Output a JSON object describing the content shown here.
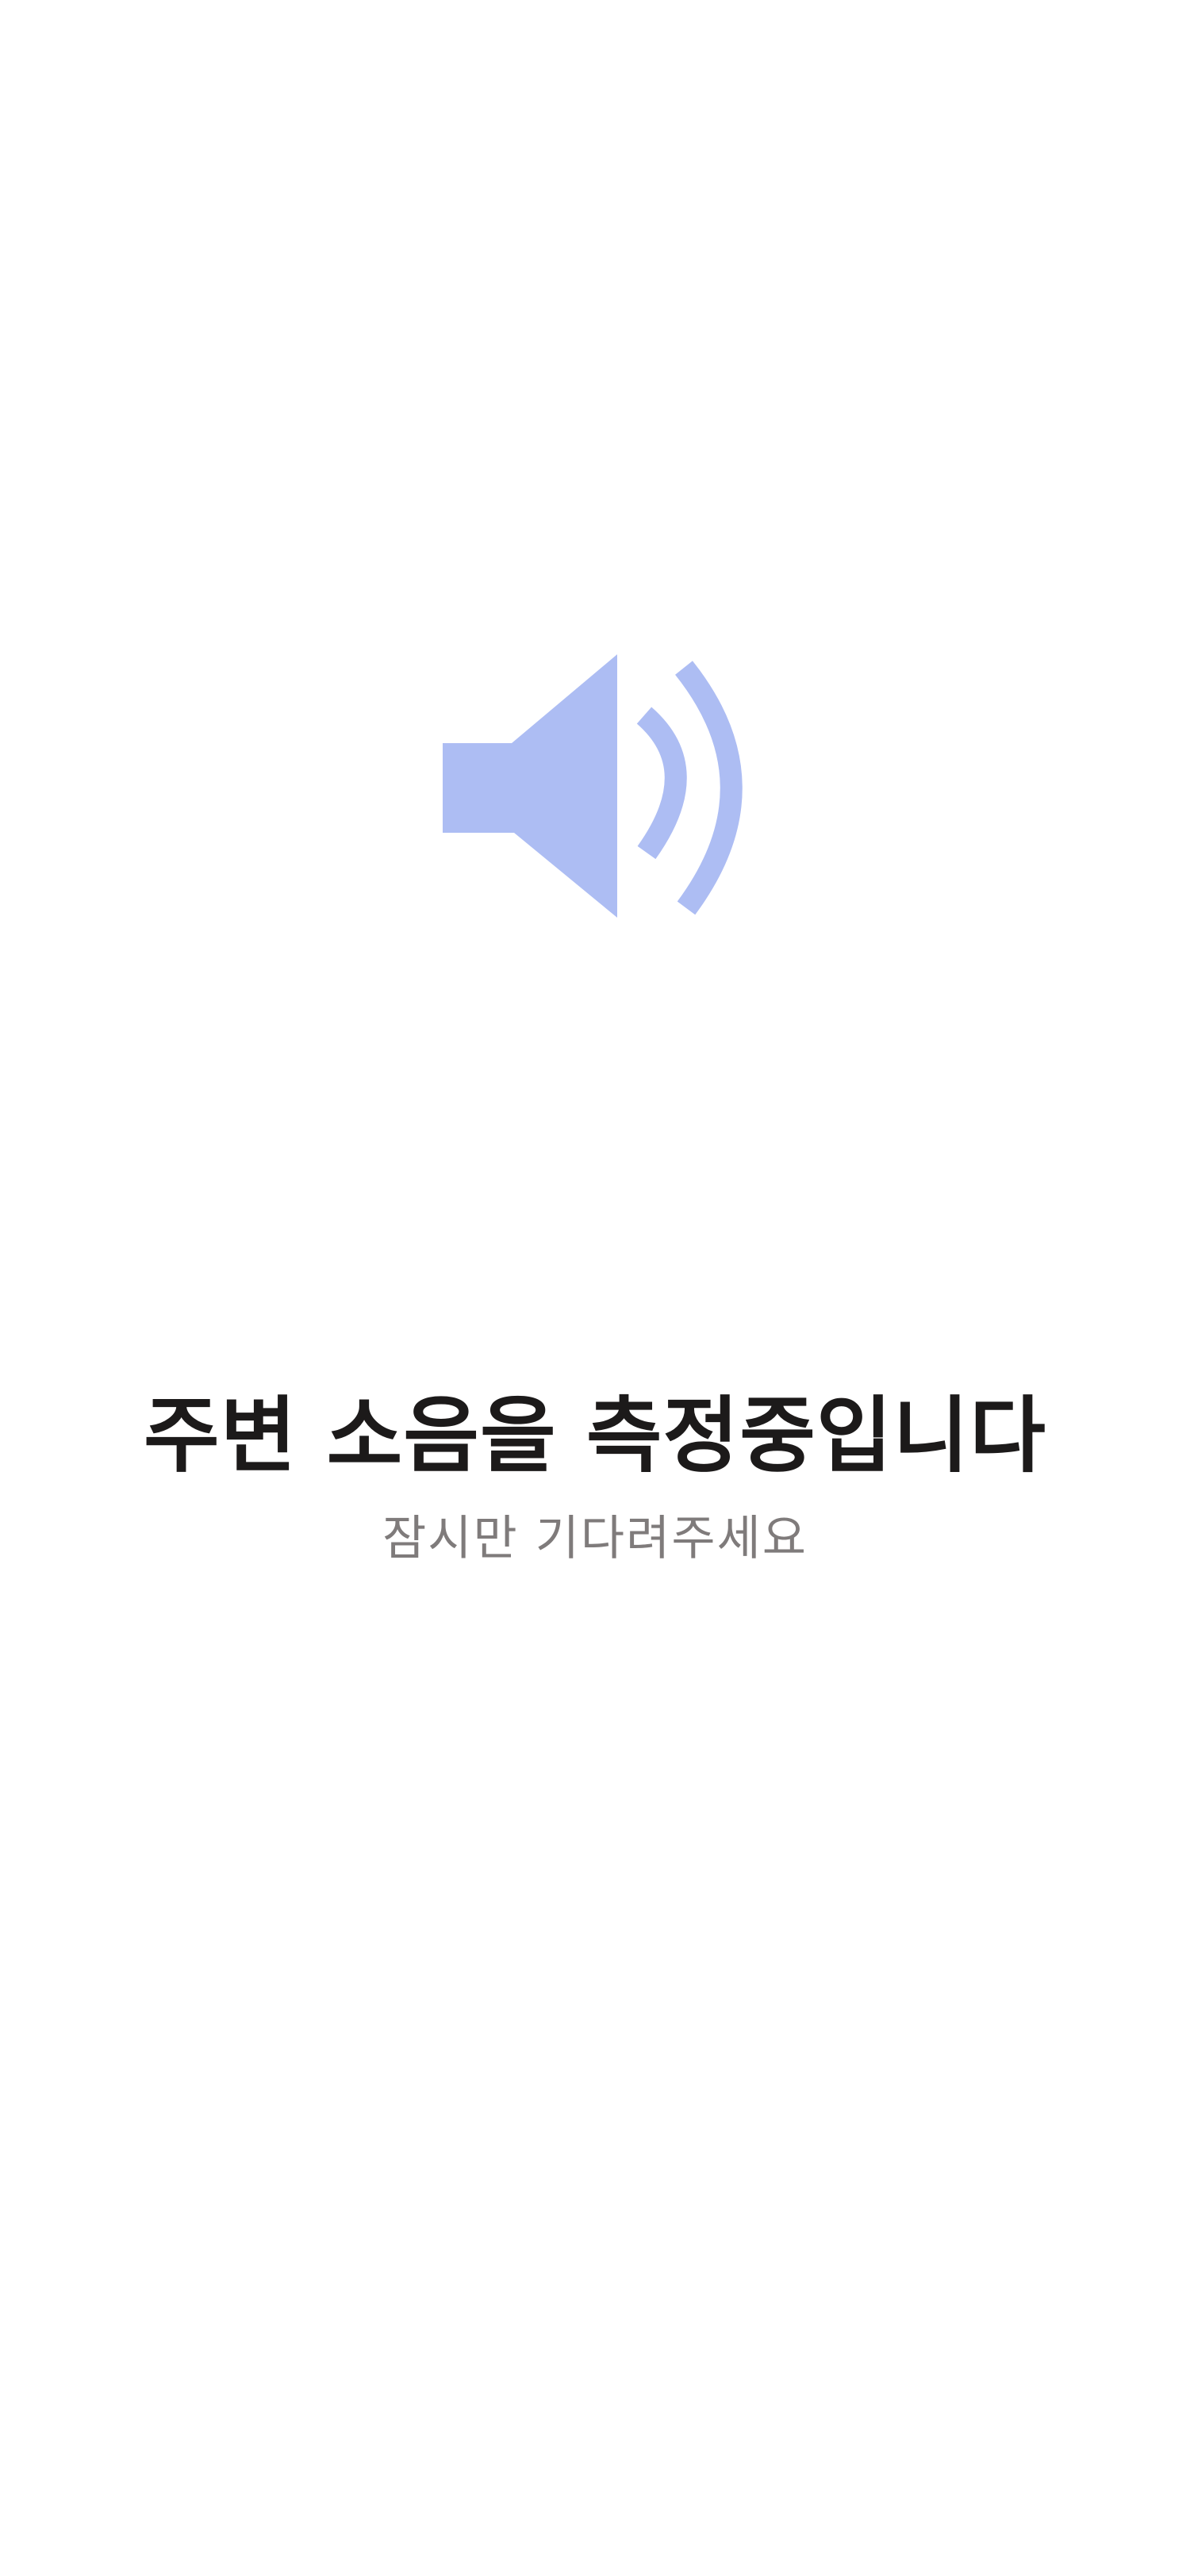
{
  "measure": {
    "title": "주변 소음을 측정중입니다",
    "subtitle": "잠시만 기다려주세요",
    "icon": "speaker-icon",
    "icon_color": "#adbdf3"
  }
}
